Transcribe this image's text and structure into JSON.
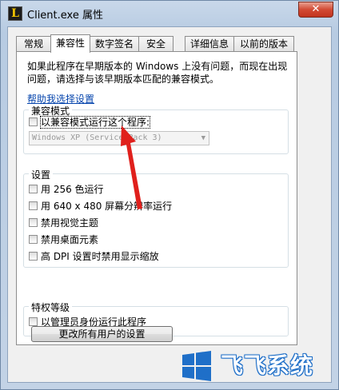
{
  "window": {
    "app_icon_letter": "L",
    "title": "Client.exe 属性",
    "close_glyph": "✕"
  },
  "tabs": [
    {
      "label": "常规"
    },
    {
      "label": "兼容性",
      "active": true
    },
    {
      "label": "数字签名"
    },
    {
      "label": "安全"
    },
    {
      "label": "详细信息"
    },
    {
      "label": "以前的版本"
    }
  ],
  "intro": {
    "text": "如果此程序在早期版本的 Windows 上没有问题，而现在出现问题，请选择与该早期版本匹配的兼容模式。",
    "help_link": "帮助我选择设置"
  },
  "compat_mode": {
    "legend": "兼容模式",
    "checkbox_label": "以兼容模式运行这个程序:",
    "select_value": "Windows XP (Service Pack 3)"
  },
  "settings": {
    "legend": "设置",
    "options": [
      "用 256 色运行",
      "用 640 x 480 屏幕分辨率运行",
      "禁用视觉主题",
      "禁用桌面元素",
      "高 DPI 设置时禁用显示缩放"
    ]
  },
  "privilege": {
    "legend": "特权等级",
    "checkbox_label": "以管理员身份运行此程序"
  },
  "change_all_button": "更改所有用户的设置",
  "watermark": {
    "text": "飞飞系统",
    "logo_icon": "windows-logo-icon",
    "brand_color": "#1f6fc8"
  },
  "annotation_color": "#e0201c"
}
